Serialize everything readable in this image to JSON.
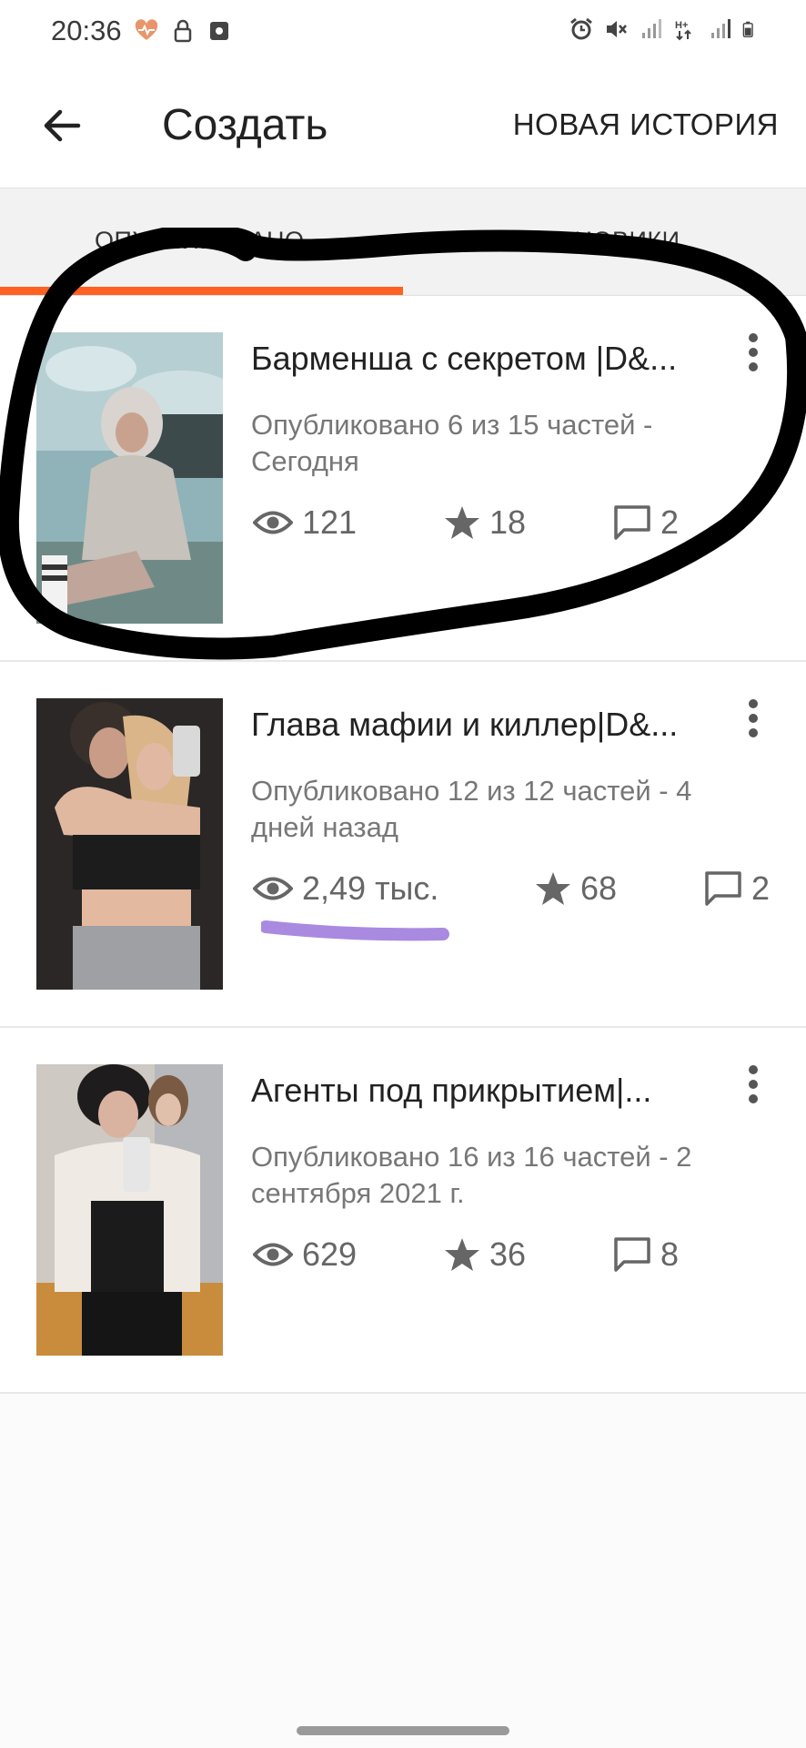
{
  "status": {
    "time": "20:36",
    "left_icons": [
      "heart-pulse-icon",
      "lock-icon",
      "screenshot-icon"
    ],
    "right_icons": [
      "alarm-icon",
      "mute-icon",
      "signal-icon",
      "network-type-icon",
      "signal-icon-2",
      "battery-icon"
    ]
  },
  "appbar": {
    "title": "Создать",
    "action": "НОВАЯ ИСТОРИЯ"
  },
  "tabs": [
    {
      "label": "ОПУБЛИКОВАНО",
      "active": true
    },
    {
      "label": "ЧЕРНОВИКИ",
      "active": false
    }
  ],
  "stories": [
    {
      "title": "Барменша с секретом |D&...",
      "meta": "Опубликовано 6 из 15 частей - Сегодня",
      "views": "121",
      "votes": "18",
      "comments": "2"
    },
    {
      "title": "Глава мафии и киллер|D&...",
      "meta": "Опубликовано 12 из 12 частей - 4 дней назад",
      "views": "2,49 тыс.",
      "votes": "68",
      "comments": "2"
    },
    {
      "title": "Агенты под прикрытием|...",
      "meta": "Опубликовано 16 из 16 частей - 2 сентября 2021 г.",
      "views": "629",
      "votes": "36",
      "comments": "8"
    }
  ],
  "colors": {
    "accent": "#ff6122",
    "annotation_black": "#000000",
    "annotation_purple": "#a98ae0"
  }
}
